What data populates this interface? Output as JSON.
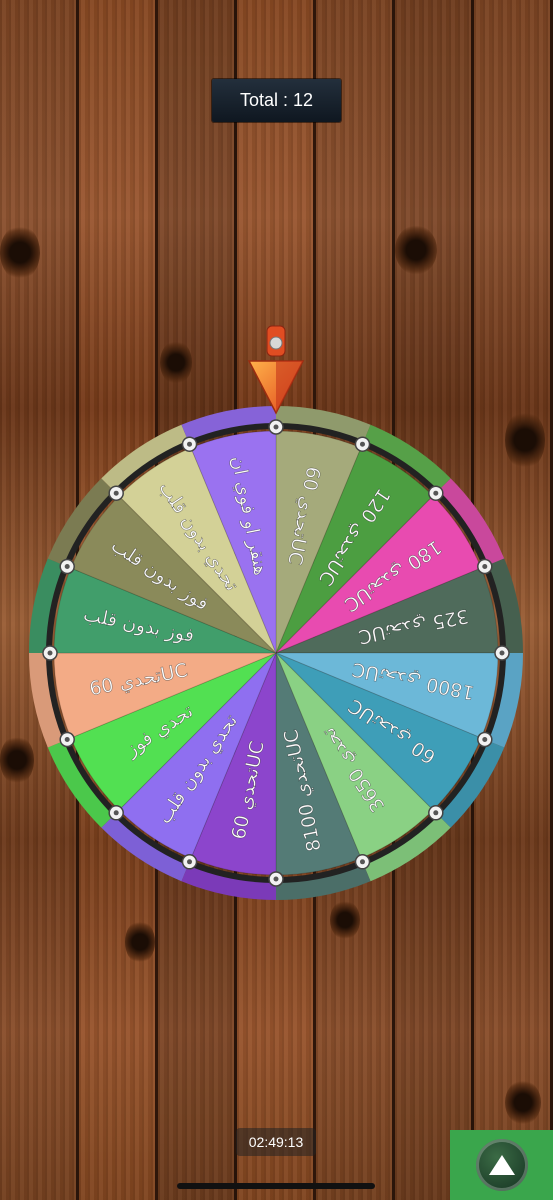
{
  "total_label": "Total : 12",
  "timer": "02:49:13",
  "spin_icon": "triangle-up-icon",
  "wheel": {
    "segments": [
      {
        "label": "تحدي 60UC",
        "color": "#a5aa7b"
      },
      {
        "label": "تحدي 120UC",
        "color": "#4c9e41"
      },
      {
        "label": "تحدي 180UC",
        "color": "#e84bb0"
      },
      {
        "label": "تحدي 325UC",
        "color": "#4f6b5b"
      },
      {
        "label": "تحدي 1800UC",
        "color": "#6cb8d8"
      },
      {
        "label": "تحدي 60UC",
        "color": "#3e9eb8"
      },
      {
        "label": "تحدي 3650",
        "color": "#8ad184"
      },
      {
        "label": "تحدي 8100UC",
        "color": "#547b76"
      },
      {
        "label": "تحدي 60UC",
        "color": "#8c45cc"
      },
      {
        "label": "تحدي بدون قلب",
        "color": "#8f6ff0"
      },
      {
        "label": "تحدي فوز",
        "color": "#52e052"
      },
      {
        "label": "تحدي 60UC",
        "color": "#f3ab86"
      },
      {
        "label": "فوز بدون قلب",
        "color": "#419e6b"
      },
      {
        "label": "فوز بدون قلب",
        "color": "#8a8a5a"
      },
      {
        "label": "تحدي بدون قلب",
        "color": "#d3d197"
      },
      {
        "label": "هنقر او فوي ان",
        "color": "#9a72f0"
      }
    ],
    "outer_ring_colors": [
      "#8f9a6c",
      "#56a048",
      "#c9489c",
      "#46604f",
      "#5aa3c4",
      "#3b8fa8",
      "#7cbf77",
      "#4b6e68",
      "#7b3ab8",
      "#7d60d6",
      "#4bc84b",
      "#d99a79",
      "#3a8d60",
      "#7b7b52",
      "#bdbb86",
      "#8663d8"
    ]
  }
}
